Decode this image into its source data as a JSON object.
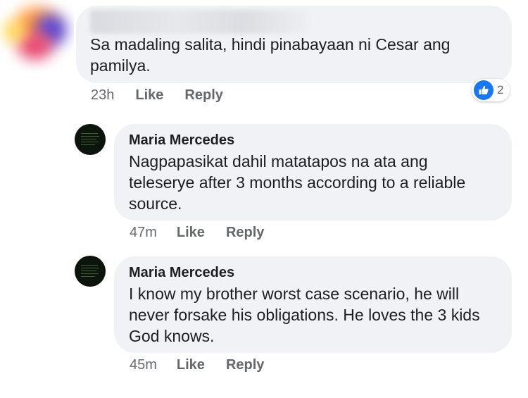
{
  "comments": [
    {
      "author": "",
      "text_lines": [
        "Sa madaling salita, hindi pinabayaan ni Cesar ang",
        "pamilya."
      ],
      "time": "23h",
      "like_label": "Like",
      "reply_label": "Reply",
      "reaction_count": "2"
    },
    {
      "author": "Maria Mercedes",
      "text_lines": [
        "Nagpapasikat dahil matatapos na ata ang",
        "teleserye after 3 months according to a reliable",
        "source."
      ],
      "time": "47m",
      "like_label": "Like",
      "reply_label": "Reply"
    },
    {
      "author": "Maria Mercedes",
      "text_lines": [
        "I know my brother worst case scenario, he will",
        "never forsake his obligations. He loves the 3 kids",
        "God knows."
      ],
      "time": "45m",
      "like_label": "Like",
      "reply_label": "Reply"
    }
  ],
  "icons": {
    "reaction": "thumbs-up-icon"
  },
  "colors": {
    "bubble": "#f0f2f5",
    "like_blue": "#1877f2",
    "meta_text": "#65676b"
  }
}
